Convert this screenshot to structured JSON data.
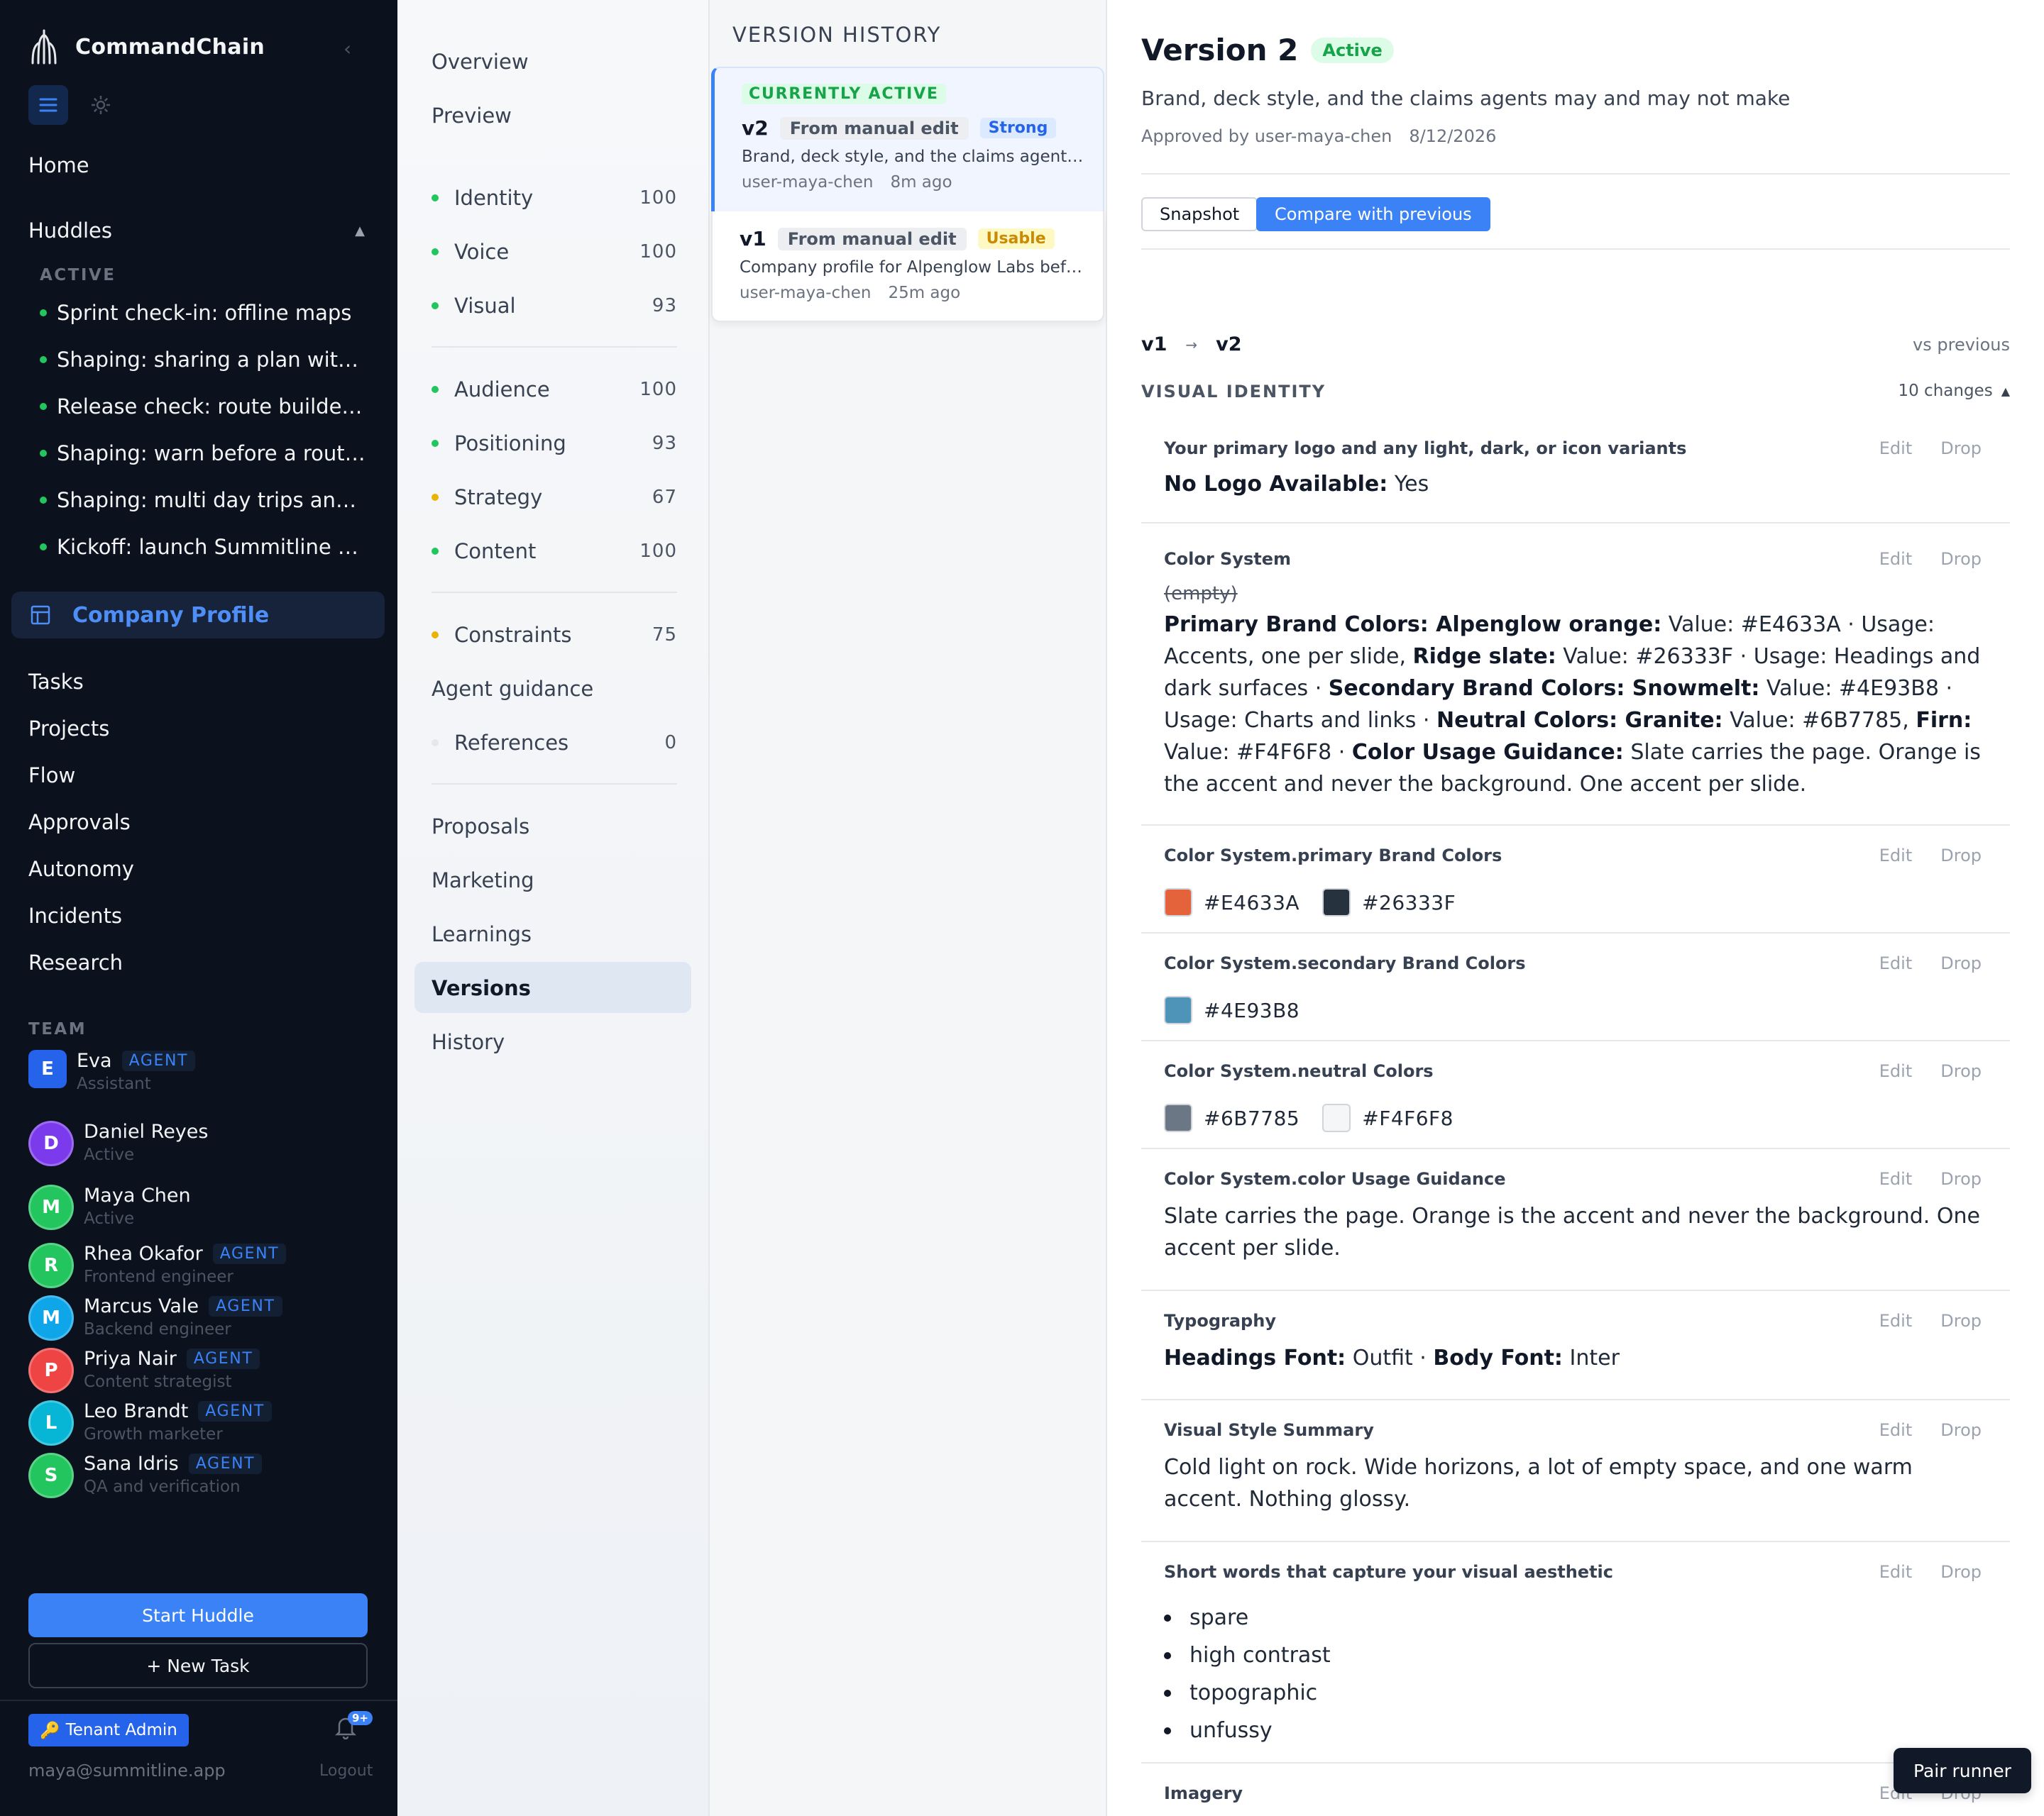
{
  "app": {
    "name": "CommandChain"
  },
  "sidebar": {
    "home": "Home",
    "huddles": {
      "label": "Huddles",
      "section": "ACTIVE",
      "items": [
        "Sprint check-in: offline maps",
        "Shaping: sharing a plan with t...",
        "Release check: route builder b...",
        "Shaping: warn before a route ...",
        "Shaping: multi day trips and c...",
        "Kickoff: launch Summitline beta"
      ]
    },
    "company_profile": "Company Profile",
    "links": [
      "Tasks",
      "Projects",
      "Flow",
      "Approvals",
      "Autonomy",
      "Incidents",
      "Research"
    ],
    "team_label": "TEAM",
    "team": [
      {
        "initial": "E",
        "name": "Eva",
        "badge": "AGENT",
        "sub": "Assistant",
        "color": "#2563eb"
      },
      {
        "initial": "D",
        "name": "Daniel Reyes",
        "badge": "",
        "sub": "Active",
        "color": "#7c3aed"
      },
      {
        "initial": "M",
        "name": "Maya Chen",
        "badge": "",
        "sub": "Active",
        "color": "#22c55e"
      },
      {
        "initial": "R",
        "name": "Rhea Okafor",
        "badge": "AGENT",
        "sub": "Frontend engineer",
        "color": "#22c55e"
      },
      {
        "initial": "M",
        "name": "Marcus Vale",
        "badge": "AGENT",
        "sub": "Backend engineer",
        "color": "#0ea5e9"
      },
      {
        "initial": "P",
        "name": "Priya Nair",
        "badge": "AGENT",
        "sub": "Content strategist",
        "color": "#ef4444"
      },
      {
        "initial": "L",
        "name": "Leo Brandt",
        "badge": "AGENT",
        "sub": "Growth marketer",
        "color": "#06b6d4"
      },
      {
        "initial": "S",
        "name": "Sana Idris",
        "badge": "AGENT",
        "sub": "QA and verification",
        "color": "#22c55e"
      }
    ],
    "start_huddle": "Start Huddle",
    "new_task": "+ New Task",
    "tenant_admin": "Tenant Admin",
    "notif_count": "9+",
    "email": "maya@summitline.app",
    "logout": "Logout"
  },
  "secnav": {
    "overview": "Overview",
    "preview": "Preview",
    "group1": [
      {
        "label": "Identity",
        "score": "100",
        "color": "#22c55e"
      },
      {
        "label": "Voice",
        "score": "100",
        "color": "#22c55e"
      },
      {
        "label": "Visual",
        "score": "93",
        "color": "#22c55e"
      }
    ],
    "group2": [
      {
        "label": "Audience",
        "score": "100",
        "color": "#22c55e"
      },
      {
        "label": "Positioning",
        "score": "93",
        "color": "#22c55e"
      },
      {
        "label": "Strategy",
        "score": "67",
        "color": "#eab308"
      },
      {
        "label": "Content",
        "score": "100",
        "color": "#22c55e"
      }
    ],
    "constraints": {
      "label": "Constraints",
      "score": "75",
      "color": "#eab308"
    },
    "agent_guidance": "Agent guidance",
    "references": {
      "label": "References",
      "score": "0",
      "color": "#e5e7eb"
    },
    "proposals": "Proposals",
    "marketing": "Marketing",
    "learnings": "Learnings",
    "versions": "Versions",
    "history": "History"
  },
  "version_history": {
    "title": "VERSION HISTORY",
    "cards": [
      {
        "current": "CURRENTLY ACTIVE",
        "version": "v2",
        "source": "From manual edit",
        "tag": "Strong",
        "tag_color": "#2563eb",
        "tag_bg": "#dbeafe",
        "desc": "Brand, deck style, and the claims agents may and may not make",
        "user": "user-maya-chen",
        "time": "8m ago"
      },
      {
        "current": "",
        "version": "v1",
        "source": "From manual edit",
        "tag": "Usable",
        "tag_color": "#ca8a04",
        "tag_bg": "#fef9c3",
        "desc": "Company profile for Alpenglow Labs before the rebrand",
        "user": "user-maya-chen",
        "time": "25m ago"
      }
    ]
  },
  "detail": {
    "title": "Version 2",
    "status": "Active",
    "description": "Brand, deck style, and the claims agents may and may not make",
    "approved_by": "Approved by user-maya-chen",
    "approved_date": "8/12/2026",
    "snapshot": "Snapshot",
    "compare": "Compare with previous",
    "from": "v1",
    "to": "v2",
    "arrow": "→",
    "vs_previous": "vs previous",
    "section": "VISUAL IDENTITY",
    "changes": "10 changes",
    "edit": "Edit",
    "drop": "Drop",
    "rows": {
      "logo": {
        "label": "Your primary logo and any light, dark, or icon variants",
        "key": "No Logo Available:",
        "value": "Yes"
      },
      "color_system": {
        "label": "Color System",
        "old": "(empty)",
        "k1": "Primary Brand Colors: Alpenglow orange:",
        "t1": "Value: #E4633A · Usage: Accents, one per slide,",
        "k2": "Ridge slate:",
        "t2": "Value: #26333F · Usage: Headings and dark surfaces ·",
        "k3": "Secondary Brand Colors: Snowmelt:",
        "t3": "Value: #4E93B8 · Usage: Charts and links ·",
        "k4": "Neutral Colors: Granite:",
        "t4": "Value: #6B7785,",
        "k5": "Firn:",
        "t5": "Value: #F4F6F8 ·",
        "k6": "Color Usage Guidance:",
        "t6": "Slate carries the page. Orange is the accent and never the background. One accent per slide."
      },
      "primary": {
        "label": "Color System.primary Brand Colors",
        "colors": [
          {
            "hex": "#E4633A"
          },
          {
            "hex": "#26333F"
          }
        ]
      },
      "secondary": {
        "label": "Color System.secondary Brand Colors",
        "colors": [
          {
            "hex": "#4E93B8"
          }
        ]
      },
      "neutral": {
        "label": "Color System.neutral Colors",
        "colors": [
          {
            "hex": "#6B7785"
          },
          {
            "hex": "#F4F6F8"
          }
        ]
      },
      "guidance": {
        "label": "Color System.color Usage Guidance",
        "value": "Slate carries the page. Orange is the accent and never the background. One accent per slide."
      },
      "typography": {
        "label": "Typography",
        "k1": "Headings Font:",
        "v1": "Outfit ·",
        "k2": "Body Font:",
        "v2": "Inter"
      },
      "style_summary": {
        "label": "Visual Style Summary",
        "value": "Cold light on rock. Wide horizons, a lot of empty space, and one warm accent. Nothing glossy."
      },
      "aesthetic": {
        "label": "Short words that capture your visual aesthetic",
        "items": [
          "spare",
          "high contrast",
          "topographic",
          "unfussy"
        ]
      },
      "imagery": {
        "label": "Imagery"
      }
    }
  },
  "pair_runner": "Pair runner"
}
